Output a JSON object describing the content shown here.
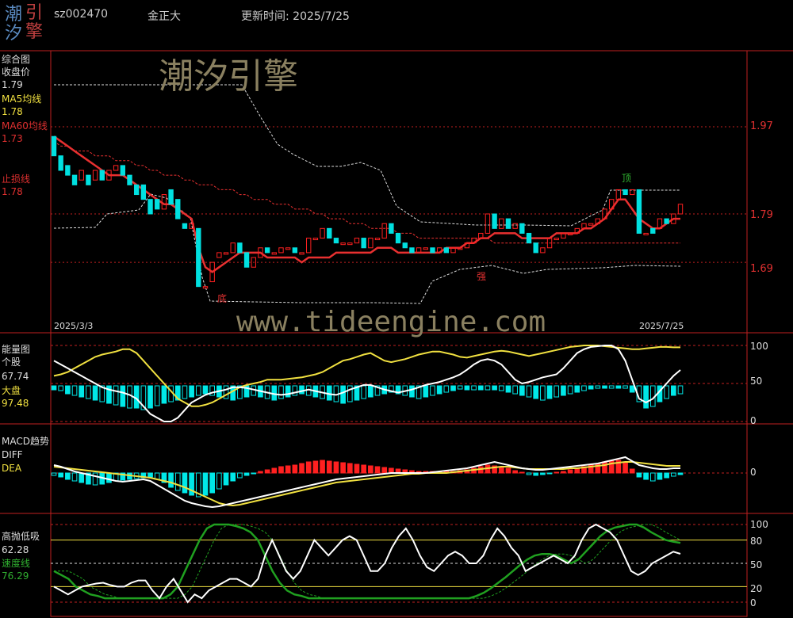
{
  "header": {
    "logo": [
      "潮",
      "引",
      "汐",
      "擎"
    ],
    "code": "sz002470",
    "name": "金正大",
    "update": "更新时间: 2025/7/25"
  },
  "watermark": {
    "brand": "潮汐引擎",
    "url": "www.tideengine.com"
  },
  "colors": {
    "border": "#c02020",
    "candle_up": "#ff2020",
    "candle_down": "#00e0e0",
    "ma5": "#ffffff",
    "ma60": "#e83030",
    "yellow": "#f0e040",
    "cyan": "#00e8e8",
    "green": "#20a020",
    "dash": "#dddddd"
  },
  "panels": {
    "main": {
      "title": "综合图",
      "labels": [
        {
          "name": "收盘价",
          "value": "1.79"
        },
        {
          "name": "MA5均线",
          "value": "1.78"
        },
        {
          "name": "MA60均线",
          "value": "1.73"
        },
        {
          "name": "止损线",
          "value": "1.78"
        }
      ],
      "axis_ticks": [
        "1.97",
        "1.79",
        "1.69"
      ],
      "date_start": "2025/3/3",
      "date_end": "2025/7/25",
      "annotations": {
        "top": "顶",
        "strong": "强",
        "bottom": "底"
      }
    },
    "energy": {
      "title": "能量图",
      "labels": [
        {
          "name": "个股",
          "value": "67.74"
        },
        {
          "name": "大盘",
          "value": "97.48"
        }
      ],
      "axis_ticks": [
        "100",
        "50",
        "0"
      ]
    },
    "macd": {
      "title": "MACD趋势",
      "labels": [
        {
          "name": "DIFF"
        },
        {
          "name": "DEA"
        }
      ],
      "axis_ticks": [
        "0"
      ]
    },
    "osc": {
      "title": "高抛低吸",
      "labels": [
        {
          "name": "62.28"
        },
        {
          "name": "速度线",
          "value": "76.29"
        }
      ],
      "axis_ticks": [
        "100",
        "80",
        "50",
        "20",
        "0"
      ]
    }
  },
  "chart_data": {
    "type": "candlestick",
    "y_ticks": [
      1.97,
      1.79,
      1.69
    ],
    "candles": [
      [
        1.95,
        1.91
      ],
      [
        1.91,
        1.88
      ],
      [
        1.89,
        1.87
      ],
      [
        1.87,
        1.85
      ],
      [
        1.86,
        1.88
      ],
      [
        1.87,
        1.85
      ],
      [
        1.86,
        1.88
      ],
      [
        1.88,
        1.86
      ],
      [
        1.86,
        1.88
      ],
      [
        1.88,
        1.89
      ],
      [
        1.89,
        1.87
      ],
      [
        1.87,
        1.85
      ],
      [
        1.85,
        1.83
      ],
      [
        1.85,
        1.82
      ],
      [
        1.82,
        1.79
      ],
      [
        1.82,
        1.8
      ],
      [
        1.8,
        1.83
      ],
      [
        1.84,
        1.81
      ],
      [
        1.82,
        1.78
      ],
      [
        1.77,
        1.76
      ],
      [
        1.76,
        1.77
      ],
      [
        1.76,
        1.64
      ],
      [
        1.64,
        1.64
      ],
      [
        1.65,
        1.69
      ],
      [
        1.7,
        1.71
      ],
      [
        1.71,
        1.71
      ],
      [
        1.71,
        1.73
      ],
      [
        1.73,
        1.71
      ],
      [
        1.71,
        1.68
      ],
      [
        1.68,
        1.7
      ],
      [
        1.7,
        1.72
      ],
      [
        1.72,
        1.71
      ],
      [
        1.71,
        1.71
      ],
      [
        1.71,
        1.72
      ],
      [
        1.72,
        1.72
      ],
      [
        1.72,
        1.71
      ],
      [
        1.71,
        1.71
      ],
      [
        1.71,
        1.74
      ],
      [
        1.74,
        1.74
      ],
      [
        1.74,
        1.76
      ],
      [
        1.76,
        1.74
      ],
      [
        1.74,
        1.73
      ],
      [
        1.73,
        1.73
      ],
      [
        1.73,
        1.73
      ],
      [
        1.73,
        1.74
      ],
      [
        1.74,
        1.72
      ],
      [
        1.72,
        1.74
      ],
      [
        1.74,
        1.74
      ],
      [
        1.74,
        1.77
      ],
      [
        1.77,
        1.75
      ],
      [
        1.75,
        1.73
      ],
      [
        1.73,
        1.72
      ],
      [
        1.72,
        1.71
      ],
      [
        1.71,
        1.72
      ],
      [
        1.72,
        1.72
      ],
      [
        1.72,
        1.71
      ],
      [
        1.71,
        1.72
      ],
      [
        1.72,
        1.71
      ],
      [
        1.71,
        1.72
      ],
      [
        1.72,
        1.72
      ],
      [
        1.72,
        1.73
      ],
      [
        1.73,
        1.74
      ],
      [
        1.74,
        1.75
      ],
      [
        1.75,
        1.79
      ],
      [
        1.79,
        1.76
      ],
      [
        1.76,
        1.78
      ],
      [
        1.78,
        1.76
      ],
      [
        1.76,
        1.77
      ],
      [
        1.77,
        1.75
      ],
      [
        1.75,
        1.73
      ],
      [
        1.73,
        1.71
      ],
      [
        1.71,
        1.72
      ],
      [
        1.72,
        1.74
      ],
      [
        1.74,
        1.74
      ],
      [
        1.74,
        1.75
      ],
      [
        1.75,
        1.75
      ],
      [
        1.75,
        1.76
      ],
      [
        1.76,
        1.77
      ],
      [
        1.77,
        1.77
      ],
      [
        1.77,
        1.78
      ],
      [
        1.78,
        1.8
      ],
      [
        1.8,
        1.82
      ],
      [
        1.82,
        1.84
      ],
      [
        1.84,
        1.83
      ],
      [
        1.83,
        1.84
      ],
      [
        1.84,
        1.75
      ],
      [
        1.75,
        1.75
      ],
      [
        1.76,
        1.75
      ],
      [
        1.76,
        1.78
      ],
      [
        1.78,
        1.77
      ],
      [
        1.77,
        1.79
      ],
      [
        1.79,
        1.81
      ]
    ],
    "ma5": [
      1.95,
      1.94,
      1.93,
      1.92,
      1.91,
      1.9,
      1.89,
      1.88,
      1.87,
      1.87,
      1.87,
      1.86,
      1.85,
      1.84,
      1.83,
      1.82,
      1.81,
      1.81,
      1.8,
      1.79,
      1.78,
      1.72,
      1.68,
      1.67,
      1.68,
      1.69,
      1.7,
      1.71,
      1.71,
      1.71,
      1.71,
      1.7,
      1.7,
      1.7,
      1.7,
      1.7,
      1.69,
      1.7,
      1.7,
      1.7,
      1.7,
      1.71,
      1.71,
      1.71,
      1.71,
      1.71,
      1.71,
      1.72,
      1.72,
      1.72,
      1.71,
      1.71,
      1.71,
      1.71,
      1.71,
      1.71,
      1.71,
      1.72,
      1.72,
      1.72,
      1.73,
      1.73,
      1.74,
      1.74,
      1.75,
      1.75,
      1.75,
      1.75,
      1.74,
      1.74,
      1.74,
      1.74,
      1.74,
      1.75,
      1.75,
      1.75,
      1.75,
      1.76,
      1.76,
      1.77,
      1.78,
      1.8,
      1.82,
      1.82,
      1.8,
      1.78,
      1.77,
      1.76,
      1.76,
      1.77,
      1.78,
      1.78
    ],
    "ma60": [
      1.94,
      1.93,
      1.93,
      1.92,
      1.92,
      1.92,
      1.91,
      1.91,
      1.91,
      1.9,
      1.9,
      1.9,
      1.89,
      1.89,
      1.88,
      1.88,
      1.87,
      1.87,
      1.87,
      1.86,
      1.86,
      1.85,
      1.85,
      1.85,
      1.84,
      1.84,
      1.84,
      1.83,
      1.83,
      1.82,
      1.82,
      1.82,
      1.81,
      1.81,
      1.81,
      1.8,
      1.8,
      1.8,
      1.79,
      1.79,
      1.78,
      1.78,
      1.78,
      1.77,
      1.77,
      1.77,
      1.76,
      1.76,
      1.76,
      1.76,
      1.75,
      1.75,
      1.75,
      1.74,
      1.74,
      1.74,
      1.74,
      1.74,
      1.74,
      1.74,
      1.74,
      1.74,
      1.74,
      1.74,
      1.73,
      1.73,
      1.73,
      1.73,
      1.73,
      1.73,
      1.73,
      1.73,
      1.73,
      1.73,
      1.73,
      1.73,
      1.73,
      1.73,
      1.73,
      1.73,
      1.73,
      1.73,
      1.73,
      1.73,
      1.73,
      1.73,
      1.73,
      1.73,
      1.73,
      1.73,
      1.73,
      1.73
    ],
    "energy_bars": [
      -5,
      -6,
      -10,
      -12,
      -14,
      -16,
      -18,
      -20,
      -22,
      -24,
      -26,
      -28,
      -28,
      -30,
      -28,
      -25,
      -22,
      -20,
      -18,
      -16,
      -14,
      -12,
      -10,
      -12,
      -14,
      -16,
      -18,
      -16,
      -14,
      -12,
      -14,
      -16,
      -18,
      -16,
      -14,
      -12,
      -10,
      -12,
      -14,
      -16,
      -18,
      -20,
      -22,
      -20,
      -18,
      -16,
      -14,
      -12,
      -10,
      -8,
      -10,
      -12,
      -14,
      -16,
      -14,
      -12,
      -10,
      -8,
      -6,
      -4,
      -5,
      -5,
      -5,
      -5,
      -5,
      -6,
      -8,
      -10,
      -12,
      -14,
      -16,
      -18,
      -16,
      -14,
      -12,
      -10,
      -8,
      -6,
      -4,
      -3,
      -3,
      -3,
      -3,
      -3,
      -8,
      -20,
      -28,
      -26,
      -20,
      -16,
      -12,
      -10
    ],
    "energy_white": [
      80,
      75,
      70,
      65,
      60,
      55,
      50,
      45,
      42,
      40,
      38,
      35,
      30,
      20,
      10,
      5,
      0,
      0,
      5,
      15,
      25,
      30,
      35,
      38,
      40,
      42,
      45,
      45,
      44,
      42,
      40,
      38,
      36,
      35,
      36,
      38,
      40,
      42,
      40,
      38,
      36,
      35,
      38,
      42,
      45,
      48,
      48,
      45,
      42,
      40,
      38,
      40,
      42,
      45,
      48,
      50,
      52,
      55,
      58,
      62,
      68,
      75,
      80,
      82,
      80,
      75,
      65,
      55,
      50,
      52,
      55,
      58,
      60,
      62,
      70,
      80,
      90,
      95,
      98,
      99,
      100,
      100,
      95,
      80,
      55,
      30,
      25,
      30,
      40,
      50,
      60,
      67.74
    ],
    "energy_yellow": [
      60,
      62,
      65,
      70,
      75,
      80,
      85,
      88,
      90,
      92,
      95,
      95,
      90,
      80,
      70,
      60,
      50,
      40,
      30,
      25,
      20,
      20,
      22,
      25,
      30,
      35,
      40,
      45,
      48,
      50,
      52,
      55,
      55,
      55,
      56,
      57,
      58,
      60,
      62,
      65,
      70,
      75,
      80,
      82,
      85,
      88,
      90,
      85,
      80,
      78,
      80,
      82,
      85,
      88,
      90,
      92,
      92,
      90,
      88,
      85,
      84,
      86,
      88,
      90,
      92,
      93,
      92,
      90,
      88,
      86,
      88,
      90,
      92,
      94,
      96,
      98,
      99,
      100,
      100,
      100,
      99,
      98,
      97,
      96,
      95,
      95,
      96,
      97,
      98,
      98,
      97.48,
      97.48
    ],
    "macd_bars": [
      -3,
      -5,
      -8,
      -10,
      -12,
      -14,
      -15,
      -14,
      -12,
      -10,
      -9,
      -8,
      -7,
      -6,
      -5,
      -8,
      -12,
      -18,
      -22,
      -25,
      -28,
      -30,
      -28,
      -25,
      -20,
      -15,
      -10,
      -6,
      -3,
      -1,
      2,
      4,
      6,
      8,
      9,
      10,
      12,
      14,
      15,
      16,
      15,
      14,
      13,
      12,
      11,
      10,
      9,
      8,
      7,
      6,
      5,
      4,
      3,
      2,
      2,
      2,
      2,
      2,
      2,
      3,
      4,
      6,
      8,
      10,
      9,
      8,
      6,
      3,
      1,
      -2,
      -3,
      -2,
      -1,
      1,
      2,
      4,
      6,
      8,
      10,
      12,
      14,
      15,
      16,
      13,
      5,
      -5,
      -8,
      -10,
      -8,
      -6,
      -4,
      -2
    ],
    "macd_diff": [
      10,
      8,
      5,
      2,
      0,
      -2,
      -4,
      -6,
      -8,
      -10,
      -11,
      -10,
      -9,
      -8,
      -10,
      -15,
      -20,
      -25,
      -30,
      -35,
      -38,
      -40,
      -42,
      -43,
      -42,
      -40,
      -38,
      -36,
      -34,
      -32,
      -30,
      -28,
      -26,
      -24,
      -22,
      -20,
      -18,
      -16,
      -14,
      -12,
      -10,
      -8,
      -7,
      -6,
      -5,
      -4,
      -3,
      -2,
      -1,
      0,
      0,
      0,
      0,
      0,
      0,
      1,
      2,
      3,
      4,
      5,
      6,
      8,
      10,
      12,
      14,
      12,
      10,
      8,
      6,
      5,
      4,
      4,
      5,
      6,
      7,
      8,
      9,
      10,
      11,
      12,
      14,
      16,
      18,
      20,
      15,
      10,
      8,
      6,
      5,
      5,
      6,
      6
    ],
    "macd_dea": [
      8,
      7,
      6,
      5,
      4,
      3,
      2,
      1,
      0,
      -1,
      -2,
      -3,
      -4,
      -5,
      -6,
      -8,
      -10,
      -12,
      -15,
      -18,
      -22,
      -26,
      -30,
      -34,
      -38,
      -40,
      -41,
      -40,
      -38,
      -36,
      -34,
      -32,
      -30,
      -28,
      -26,
      -24,
      -22,
      -20,
      -18,
      -16,
      -14,
      -12,
      -11,
      -10,
      -9,
      -8,
      -7,
      -6,
      -5,
      -4,
      -3,
      -2,
      -1,
      -1,
      0,
      0,
      0,
      0,
      1,
      2,
      3,
      4,
      5,
      6,
      7,
      8,
      8,
      7,
      6,
      5,
      5,
      5,
      5,
      5,
      5,
      6,
      6,
      7,
      8,
      9,
      10,
      12,
      13,
      14,
      14,
      13,
      12,
      11,
      10,
      9,
      9,
      9
    ],
    "osc_white": [
      20,
      15,
      10,
      15,
      20,
      22,
      24,
      25,
      22,
      20,
      20,
      25,
      28,
      28,
      15,
      5,
      20,
      30,
      15,
      0,
      10,
      5,
      15,
      20,
      25,
      30,
      30,
      25,
      20,
      30,
      60,
      80,
      60,
      40,
      30,
      40,
      60,
      80,
      70,
      60,
      70,
      80,
      85,
      80,
      60,
      40,
      40,
      50,
      70,
      85,
      95,
      80,
      60,
      45,
      40,
      50,
      60,
      65,
      60,
      50,
      50,
      60,
      80,
      95,
      85,
      70,
      60,
      40,
      45,
      50,
      55,
      60,
      55,
      50,
      60,
      80,
      95,
      100,
      95,
      90,
      80,
      60,
      40,
      35,
      40,
      50,
      55,
      60,
      65,
      62.28
    ],
    "osc_green": [
      40,
      35,
      30,
      20,
      15,
      10,
      8,
      5,
      5,
      5,
      5,
      5,
      5,
      5,
      5,
      5,
      10,
      20,
      40,
      60,
      80,
      95,
      100,
      100,
      100,
      98,
      95,
      90,
      80,
      60,
      40,
      25,
      15,
      10,
      8,
      5,
      5,
      5,
      5,
      5,
      5,
      5,
      5,
      5,
      5,
      5,
      5,
      5,
      5,
      5,
      5,
      5,
      5,
      5,
      5,
      5,
      5,
      5,
      8,
      12,
      18,
      25,
      32,
      40,
      48,
      55,
      60,
      62,
      62,
      60,
      55,
      50,
      55,
      65,
      75,
      85,
      92,
      96,
      98,
      100,
      100,
      96,
      90,
      85,
      80,
      78,
      76.29
    ]
  }
}
